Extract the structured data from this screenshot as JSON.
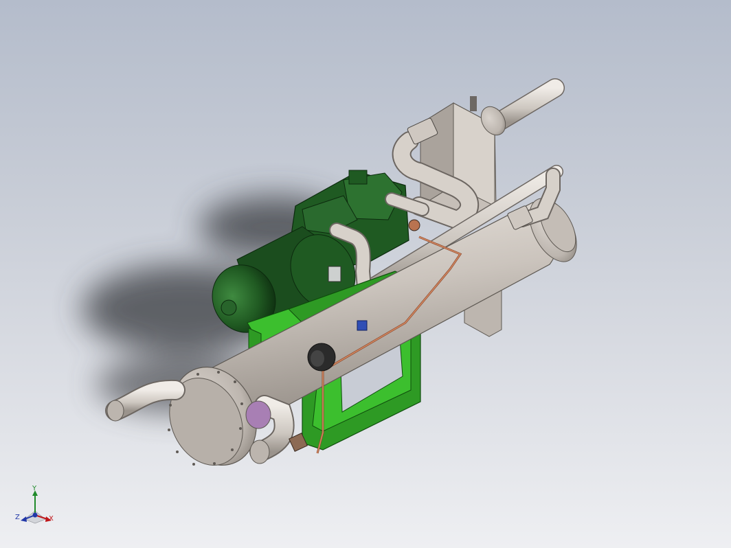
{
  "viewport": {
    "background_top": "#b4bccb",
    "background_bottom": "#eeeff2"
  },
  "model": {
    "description_icon": "chiller-assembly-3d-model",
    "colors": {
      "vessel": "#c9c2bb",
      "vessel_dark": "#8e8780",
      "frame": "#38b52c",
      "frame_dark": "#1c7418",
      "compressor": "#2a6a2e",
      "compressor_dark": "#123c16",
      "pipe": "#d2cdc7",
      "copper_line": "#b9643f",
      "shadow": "#4d4e55"
    }
  },
  "triad": {
    "icon": "coordinate-triad-icon",
    "x_label": "X",
    "y_label": "Y",
    "z_label": "Z",
    "x_color": "#c0171a",
    "y_color": "#1f8a2a",
    "z_color": "#2238a8"
  }
}
